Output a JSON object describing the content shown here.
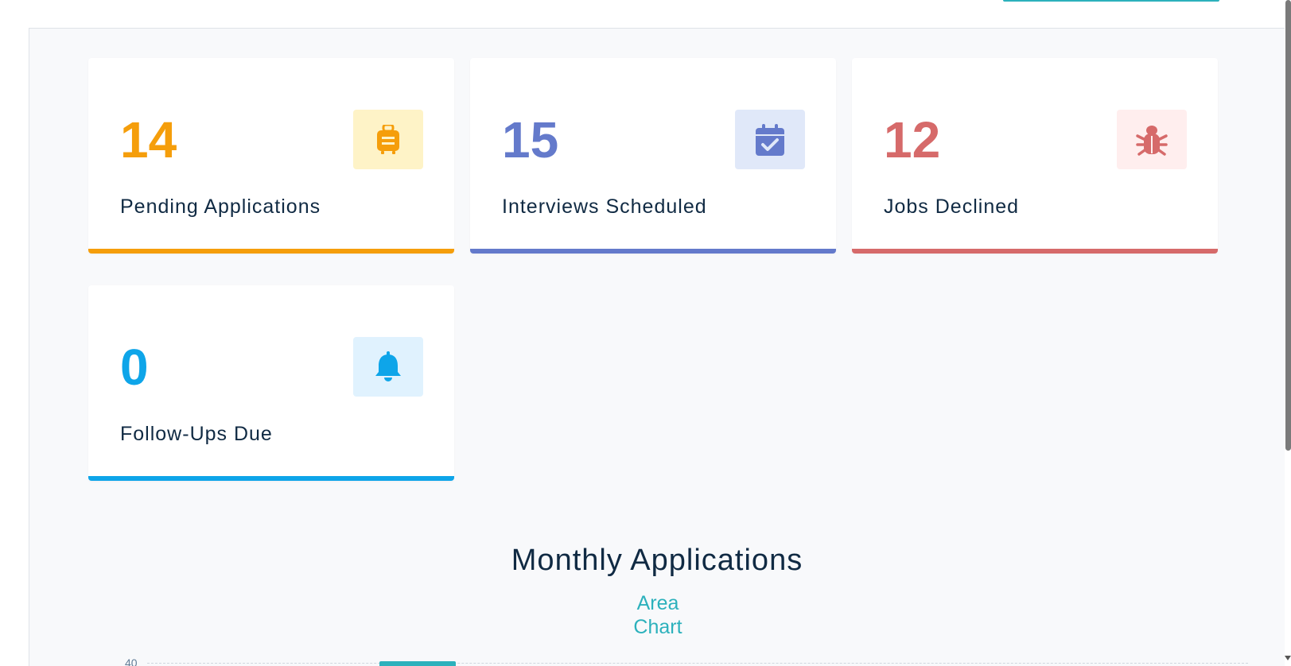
{
  "stats": [
    {
      "value": "14",
      "label": "Pending Applications",
      "icon": "suitcase-icon",
      "color": "#f59e0b",
      "bg": "#fef3c7"
    },
    {
      "value": "15",
      "label": "Interviews Scheduled",
      "icon": "calendar-check-icon",
      "color": "#647acb",
      "bg": "#e0e8f9"
    },
    {
      "value": "12",
      "label": "Jobs Declined",
      "icon": "bug-icon",
      "color": "#d66a6a",
      "bg": "#ffeeee"
    },
    {
      "value": "0",
      "label": "Follow-Ups Due",
      "icon": "bell-icon",
      "color": "#0ea5e9",
      "bg": "#e0f2fe"
    }
  ],
  "chart": {
    "title": "Monthly Applications",
    "toggle_label": "Area Chart",
    "y_tick_top": "40"
  },
  "colors": {
    "accent": "#2cb1bc",
    "page_bg": "#f8f9fb"
  }
}
